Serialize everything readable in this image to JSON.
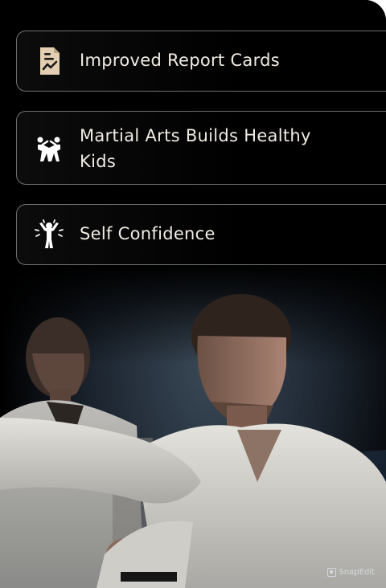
{
  "benefits": [
    {
      "label": "Improved Report Cards",
      "icon": "report-card-icon"
    },
    {
      "label": "Martial Arts Builds Healthy Kids",
      "icon": "sparring-icon"
    },
    {
      "label": "Self Confidence",
      "icon": "confident-person-icon"
    }
  ],
  "watermark": {
    "label": "SnapEdit",
    "icon": "snapedit-logo-icon"
  },
  "colors": {
    "background": "#000000",
    "text": "#f1ece4",
    "accent": "#e2cfb1"
  }
}
